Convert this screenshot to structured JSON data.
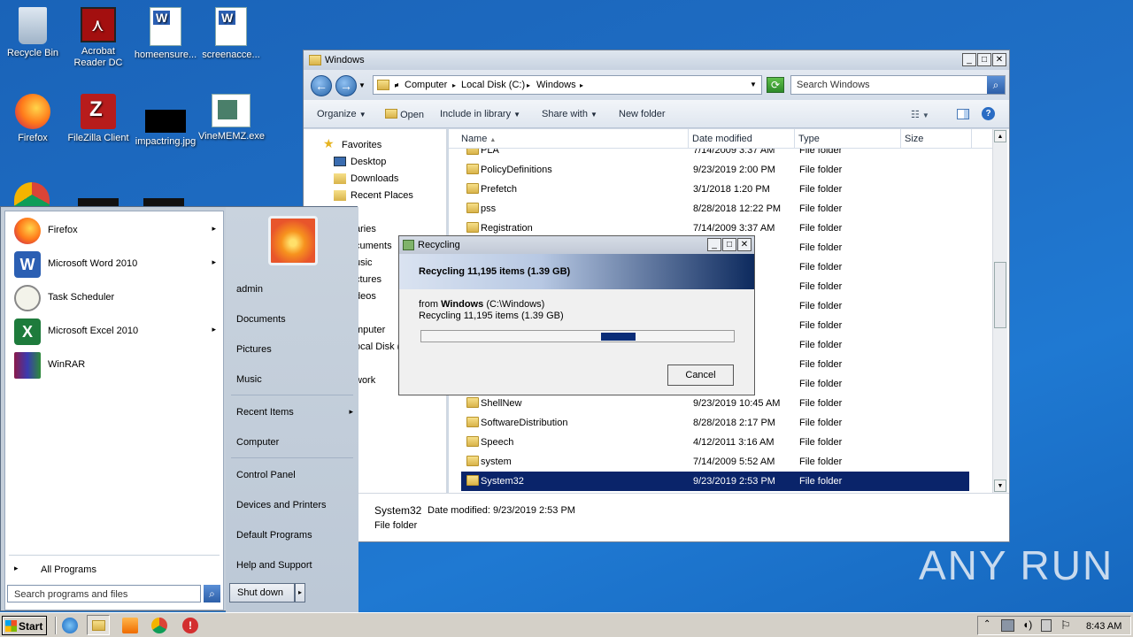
{
  "desktop": {
    "icons": [
      {
        "label": "Recycle Bin"
      },
      {
        "label": "Acrobat Reader DC"
      },
      {
        "label": "homeensure..."
      },
      {
        "label": "screenacce..."
      },
      {
        "label": "Firefox"
      },
      {
        "label": "FileZilla Client"
      },
      {
        "label": "impactring.jpg"
      },
      {
        "label": "VineMEMZ.exe"
      }
    ]
  },
  "explorer": {
    "title": "Windows",
    "breadcrumb": [
      "Computer",
      "Local Disk (C:)",
      "Windows"
    ],
    "search_placeholder": "Search Windows",
    "toolbar": {
      "organize": "Organize",
      "open": "Open",
      "include": "Include in library",
      "share": "Share with",
      "new_folder": "New folder"
    },
    "nav": {
      "favorites": "Favorites",
      "desktop": "Desktop",
      "downloads": "Downloads",
      "recent": "Recent Places",
      "libraries": "aries",
      "documents": "cuments",
      "music": "usic",
      "pictures": "ctures",
      "videos": "deos",
      "computer": "mputer",
      "localdisk": "ocal Disk (",
      "network": "work"
    },
    "columns": {
      "name": "Name",
      "date": "Date modified",
      "type": "Type",
      "size": "Size"
    },
    "rows": [
      {
        "name": "PLA",
        "date": "7/14/2009 3:37 AM",
        "type": "File folder"
      },
      {
        "name": "PolicyDefinitions",
        "date": "9/23/2019 2:00 PM",
        "type": "File folder"
      },
      {
        "name": "Prefetch",
        "date": "3/1/2018 1:20 PM",
        "type": "File folder"
      },
      {
        "name": "pss",
        "date": "8/28/2018 12:22 PM",
        "type": "File folder"
      },
      {
        "name": "Registration",
        "date": "7/14/2009 3:37 AM",
        "type": "File folder"
      },
      {
        "name": "",
        "date": "9 PM",
        "type": "File folder"
      },
      {
        "name": "",
        "date": "2 AM",
        "type": "File folder"
      },
      {
        "name": "",
        "date": "5 AM",
        "type": "File folder"
      },
      {
        "name": "",
        "date": "2 AM",
        "type": "File folder"
      },
      {
        "name": "",
        "date": "4 AM",
        "type": "File folder"
      },
      {
        "name": "",
        "date": "4 AM",
        "type": "File folder"
      },
      {
        "name": "",
        "date": "5 AM",
        "type": "File folder"
      },
      {
        "name": "",
        "date": "4 AM",
        "type": "File folder"
      },
      {
        "name": "ShellNew",
        "date": "9/23/2019 10:45 AM",
        "type": "File folder"
      },
      {
        "name": "SoftwareDistribution",
        "date": "8/28/2018 2:17 PM",
        "type": "File folder"
      },
      {
        "name": "Speech",
        "date": "4/12/2011 3:16 AM",
        "type": "File folder"
      },
      {
        "name": "system",
        "date": "7/14/2009 5:52 AM",
        "type": "File folder"
      },
      {
        "name": "System32",
        "date": "9/23/2019 2:53 PM",
        "type": "File folder"
      }
    ],
    "details": {
      "name": "System32",
      "date_label": "Date modified:",
      "date": "9/23/2019 2:53 PM",
      "type": "File folder"
    }
  },
  "dialog": {
    "title": "Recycling",
    "banner": "Recycling 11,195 items (1.39 GB)",
    "from_prefix": "from",
    "from_bold": "Windows",
    "from_path": "(C:\\Windows)",
    "status": "Recycling 11,195 items (1.39 GB)",
    "cancel": "Cancel",
    "progress_fraction": 0.11
  },
  "start_menu": {
    "programs": [
      {
        "label": "Firefox",
        "arrow": "▸"
      },
      {
        "label": "Microsoft Word 2010",
        "arrow": "▸"
      },
      {
        "label": "Task Scheduler",
        "arrow": ""
      },
      {
        "label": "Microsoft Excel 2010",
        "arrow": "▸"
      },
      {
        "label": "WinRAR",
        "arrow": ""
      }
    ],
    "all_programs": "All Programs",
    "search_placeholder": "Search programs and files",
    "right": {
      "user": "admin",
      "documents": "Documents",
      "pictures": "Pictures",
      "music": "Music",
      "recent": "Recent Items",
      "computer": "Computer",
      "control": "Control Panel",
      "devices": "Devices and Printers",
      "defaults": "Default Programs",
      "help": "Help and Support"
    },
    "shutdown": "Shut down"
  },
  "taskbar": {
    "start": "Start",
    "clock": "8:43 AM"
  },
  "watermark": "ANY RUN",
  "colors": {
    "selection": "#0a246a",
    "desktop": "#1f6fc6",
    "progress": "#0a2d78"
  }
}
